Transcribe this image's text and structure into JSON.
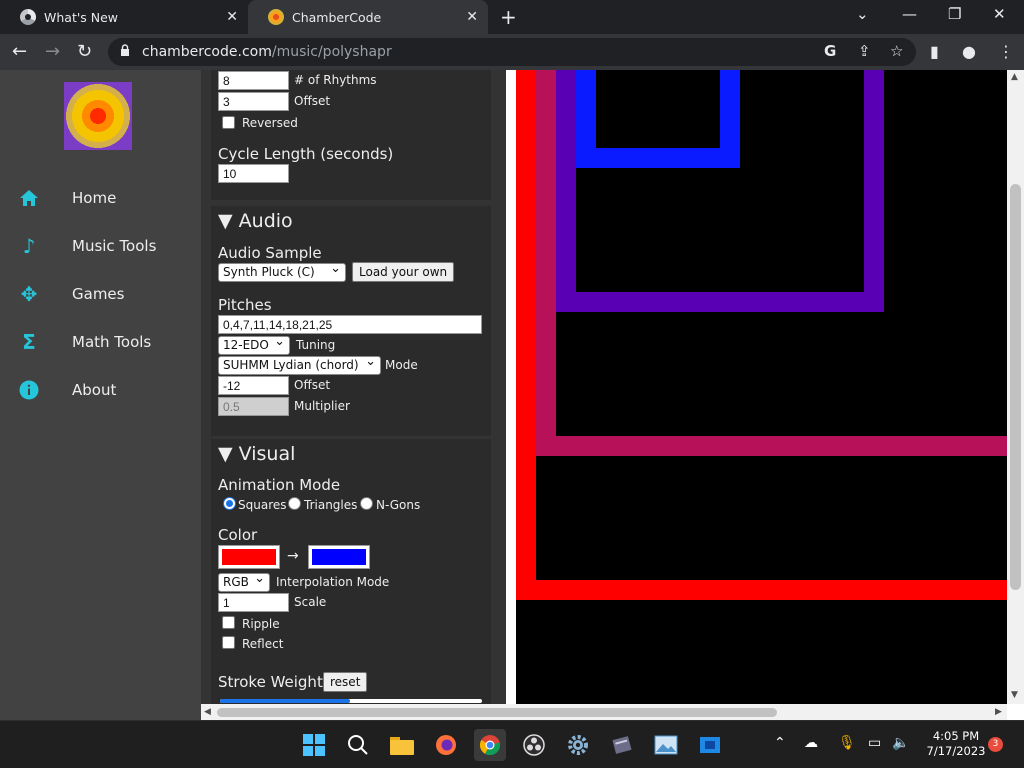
{
  "browser": {
    "tabs": [
      {
        "title": "What's New"
      },
      {
        "title": "ChamberCode"
      }
    ],
    "new_tab": "+",
    "url_host": "chambercode.com",
    "url_path": "/music/polyshapr"
  },
  "nav": {
    "items": [
      {
        "label": "Home",
        "icon": "home-icon"
      },
      {
        "label": "Music Tools",
        "icon": "music-note-icon"
      },
      {
        "label": "Games",
        "icon": "gamepad-icon"
      },
      {
        "label": "Math Tools",
        "icon": "sigma-icon"
      },
      {
        "label": "About",
        "icon": "info-icon"
      }
    ]
  },
  "rhythm": {
    "num_rhythms": "8",
    "num_rhythms_label": "# of Rhythms",
    "offset": "3",
    "offset_label": "Offset",
    "reversed_label": "Reversed",
    "cycle_length_label": "Cycle Length (seconds)",
    "cycle_length": "10"
  },
  "audio": {
    "title": "Audio",
    "sample_label": "Audio Sample",
    "sample_value": "Synth Pluck (C)",
    "load_button": "Load your own",
    "pitches_label": "Pitches",
    "pitches_value": "0,4,7,11,14,18,21,25",
    "tuning_value": "12-EDO",
    "tuning_label": "Tuning",
    "mode_value": "SUHMM Lydian (chord)",
    "mode_label": "Mode",
    "offset_value": "-12",
    "offset_label": "Offset",
    "multiplier_value": "0.5",
    "multiplier_label": "Multiplier"
  },
  "visual": {
    "title": "Visual",
    "animation_mode_label": "Animation Mode",
    "modes": [
      "Squares",
      "Triangles",
      "N-Gons"
    ],
    "selected_mode": "Squares",
    "color_label": "Color",
    "color_from": "#ff0000",
    "color_to": "#0000ff",
    "arrow": "→",
    "interpolation_value": "RGB",
    "interpolation_label": "Interpolation Mode",
    "scale_value": "1",
    "scale_label": "Scale",
    "ripple_label": "Ripple",
    "reflect_label": "Reflect",
    "stroke_weight_label": "Stroke Weight",
    "reset_button": "reset"
  },
  "canvas": {
    "square_colors": [
      "#ff0000",
      "#b7115a",
      "#5a00b4",
      "#0a1cff"
    ]
  },
  "taskbar": {
    "time": "4:05 PM",
    "date": "7/17/2023",
    "notifications": "3"
  }
}
